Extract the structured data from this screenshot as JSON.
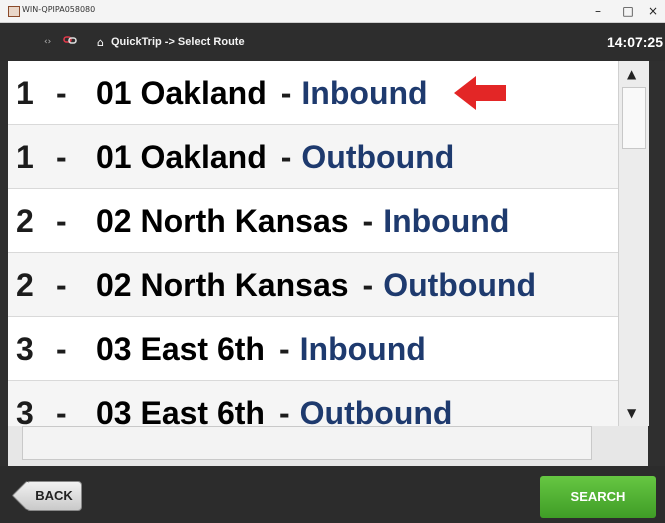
{
  "window": {
    "title": "WIN-QPIPA058080",
    "minimize_glyph": "–",
    "maximize_glyph": "□",
    "close_glyph": "×"
  },
  "header": {
    "breadcrumb": "QuickTrip -> Select Route",
    "time": "14:07:25",
    "home_icon": "home-icon",
    "status_icons": "‹›"
  },
  "routes": [
    {
      "number": "1",
      "dash": "-",
      "name": "01 Oakland",
      "direction": "Inbound",
      "selected_arrow": true
    },
    {
      "number": "1",
      "dash": "-",
      "name": "01 Oakland",
      "direction": "Outbound"
    },
    {
      "number": "2",
      "dash": "-",
      "name": "02 North Kansas",
      "direction": "Inbound"
    },
    {
      "number": "2",
      "dash": "-",
      "name": "02 North Kansas",
      "direction": "Outbound"
    },
    {
      "number": "3",
      "dash": "-",
      "name": "03 East 6th",
      "direction": "Inbound"
    },
    {
      "number": "3",
      "dash": "-",
      "name": "03 East 6th",
      "direction": "Outbound"
    }
  ],
  "route_separator": "-",
  "scroll": {
    "up_glyph": "▲",
    "down_glyph": "▼"
  },
  "footer": {
    "back_label": "BACK",
    "search_label": "SEARCH"
  },
  "colors": {
    "direction_text": "#1e3a6e",
    "arrow": "#e32626",
    "search_button": "#4fae30"
  }
}
